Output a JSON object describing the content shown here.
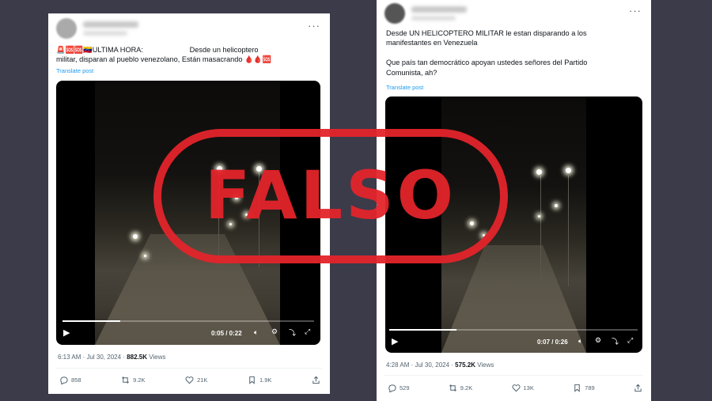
{
  "stamp": {
    "text": "FALSO",
    "color": "#e3242b"
  },
  "left_post": {
    "more_label": "···",
    "text": "🚨🆘🆘🇻🇪ULTIMA HORA:                       Desde un helicoptero\nmilitar, disparan al pueblo venezolano, Están masacrando 🩸🩸🆘",
    "translate": "Translate post",
    "video": {
      "time": "0:05 / 0:22",
      "progress": 0.23
    },
    "meta_time": "6:13 AM · Jul 30, 2024 · ",
    "views": "882.5K",
    "views_label": " Views",
    "replies": "858",
    "reposts": "9.2K",
    "likes": "21K",
    "bookmarks": "1.9K"
  },
  "right_post": {
    "more_label": "···",
    "text": "Desde UN HELICOPTERO MILITAR le estan disparando a los\nmanifestantes en Venezuela\n\nQue país tan democrático apoyan ustedes señores del Partido\nComunista, ah?",
    "translate": "Translate post",
    "video": {
      "time": "0:07 / 0:26",
      "progress": 0.27
    },
    "meta_time": "4:28 AM · Jul 30, 2024 · ",
    "views": "575.2K",
    "views_label": " Views",
    "replies": "529",
    "reposts": "9.2K",
    "likes": "13K",
    "bookmarks": "789"
  }
}
